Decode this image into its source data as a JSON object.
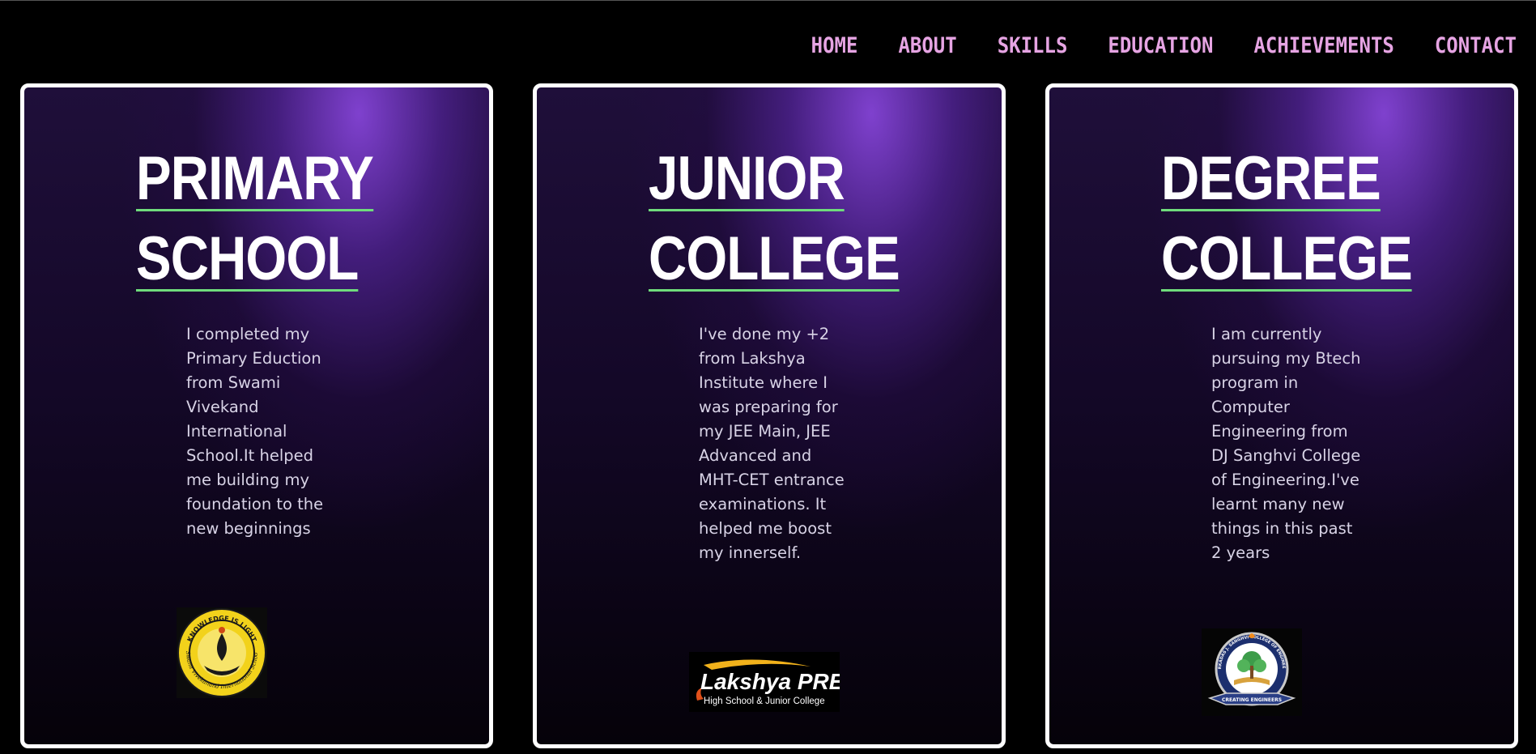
{
  "nav": {
    "items": [
      "HOME",
      "ABOUT",
      "SKILLS",
      "EDUCATION",
      "ACHIEVEMENTS",
      "CONTACT"
    ]
  },
  "cards": [
    {
      "title_line1": "PRIMARY",
      "title_line2": "SCHOOL",
      "description": "I completed my Primary Eduction from Swami Vivekand International School.It helped me building my foundation to the new beginnings",
      "logo_text_top": "KNOWLEDGE IS LIGHT",
      "logo_text_bottom": "Swami Vivekanand International School",
      "logo_icon": "school-emblem-icon"
    },
    {
      "title_line1": "JUNIOR",
      "title_line2": "COLLEGE",
      "description": "I've done my +2 from Lakshya Institute where I was preparing for my JEE Main, JEE Advanced and MHT-CET entrance examinations. It helped me boost my innerself.",
      "logo_text_top": "Lakshya PREP",
      "logo_text_bottom": "High School & Junior College",
      "logo_icon": "lakshya-logo-icon"
    },
    {
      "title_line1": "DEGREE",
      "title_line2": "COLLEGE",
      "description": "I am currently pursuing my Btech program in Computer Engineering from DJ Sanghvi College of Engineering.I've learnt many new things in this past 2 years",
      "logo_text_top": "DWARKADAS J. SANGHVI COLLEGE OF ENGINEERING",
      "logo_text_bottom": "CREATING ENGINEERS",
      "logo_icon": "college-crest-icon"
    }
  ],
  "colors": {
    "nav_text": "#e6a4e3",
    "title_underline": "#6fdc7c",
    "card_border": "#ffffff",
    "background": "#000000"
  }
}
